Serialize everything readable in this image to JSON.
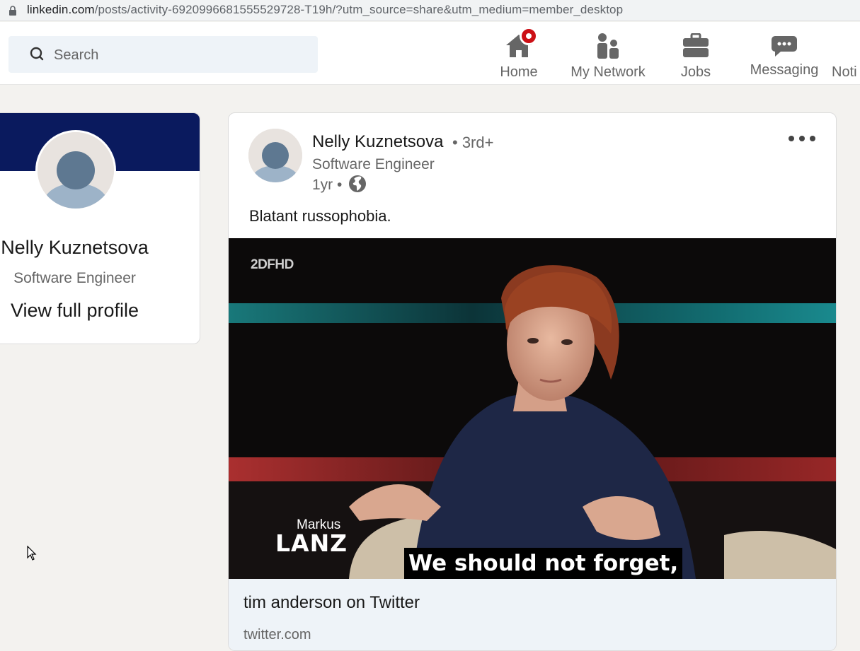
{
  "browser": {
    "url_host": "linkedin.com",
    "url_path": "/posts/activity-6920996681555529728-T19h/?utm_source=share&utm_medium=member_desktop"
  },
  "nav": {
    "search_placeholder": "Search",
    "items": [
      {
        "label": "Home",
        "icon": "home-icon"
      },
      {
        "label": "My Network",
        "icon": "network-icon"
      },
      {
        "label": "Jobs",
        "icon": "briefcase-icon"
      },
      {
        "label": "Messaging",
        "icon": "messaging-icon"
      },
      {
        "label": "Noti",
        "icon": "bell-icon"
      }
    ]
  },
  "profile_card": {
    "name": "Nelly Kuznetsova",
    "title": "Software Engineer",
    "link": "View full profile",
    "banner_color": "#0a1a5e"
  },
  "post": {
    "author": "Nelly Kuznetsova",
    "degree": "• 3rd+",
    "author_title": "Software Engineer",
    "time": "1yr •",
    "text": "Blatant russophobia.",
    "media": {
      "channel_logo": "2DFHD",
      "show_small": "Markus",
      "show_big": "LANZ",
      "caption": "We should not forget,"
    },
    "link_preview": {
      "title": "tim anderson on Twitter",
      "domain": "twitter.com"
    }
  },
  "colors": {
    "page_bg": "#f3f2ef",
    "badge": "#cc1016",
    "icon_gray": "#666666"
  }
}
